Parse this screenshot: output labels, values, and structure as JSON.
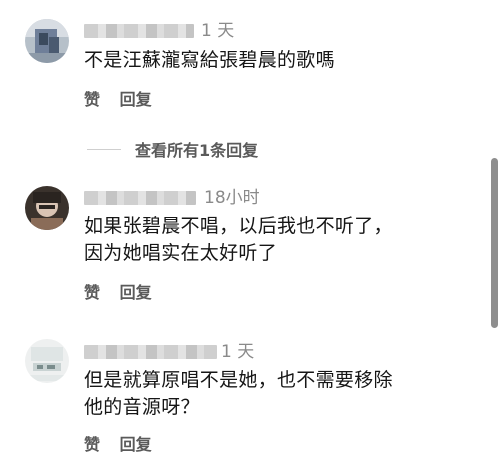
{
  "comments": [
    {
      "time": "1 天",
      "text_lines": [
        "不是汪蘇瀧寫給張碧晨的歌嗎"
      ],
      "like_label": "赞",
      "reply_label": "回复",
      "view_replies": "查看所有1条回复"
    },
    {
      "time": "18小时",
      "text_lines": [
        "如果张碧晨不唱，以后我也不听了，",
        "因为她唱实在太好听了"
      ],
      "like_label": "赞",
      "reply_label": "回复"
    },
    {
      "time": "1 天",
      "text_lines": [
        "但是就算原唱不是她，也不需要移除",
        "他的音源呀？"
      ],
      "like_label": "赞",
      "reply_label": "回复"
    }
  ],
  "avatar_colors": {
    "avatar_1": [
      "#6f7f99",
      "#3b4a5e",
      "#b6c0c9"
    ],
    "avatar_2": [
      "#2a2420",
      "#8a6c58",
      "#d9c4b4"
    ],
    "avatar_3": [
      "#e8eaea",
      "#c9d3d3",
      "#7a8c8c"
    ]
  }
}
